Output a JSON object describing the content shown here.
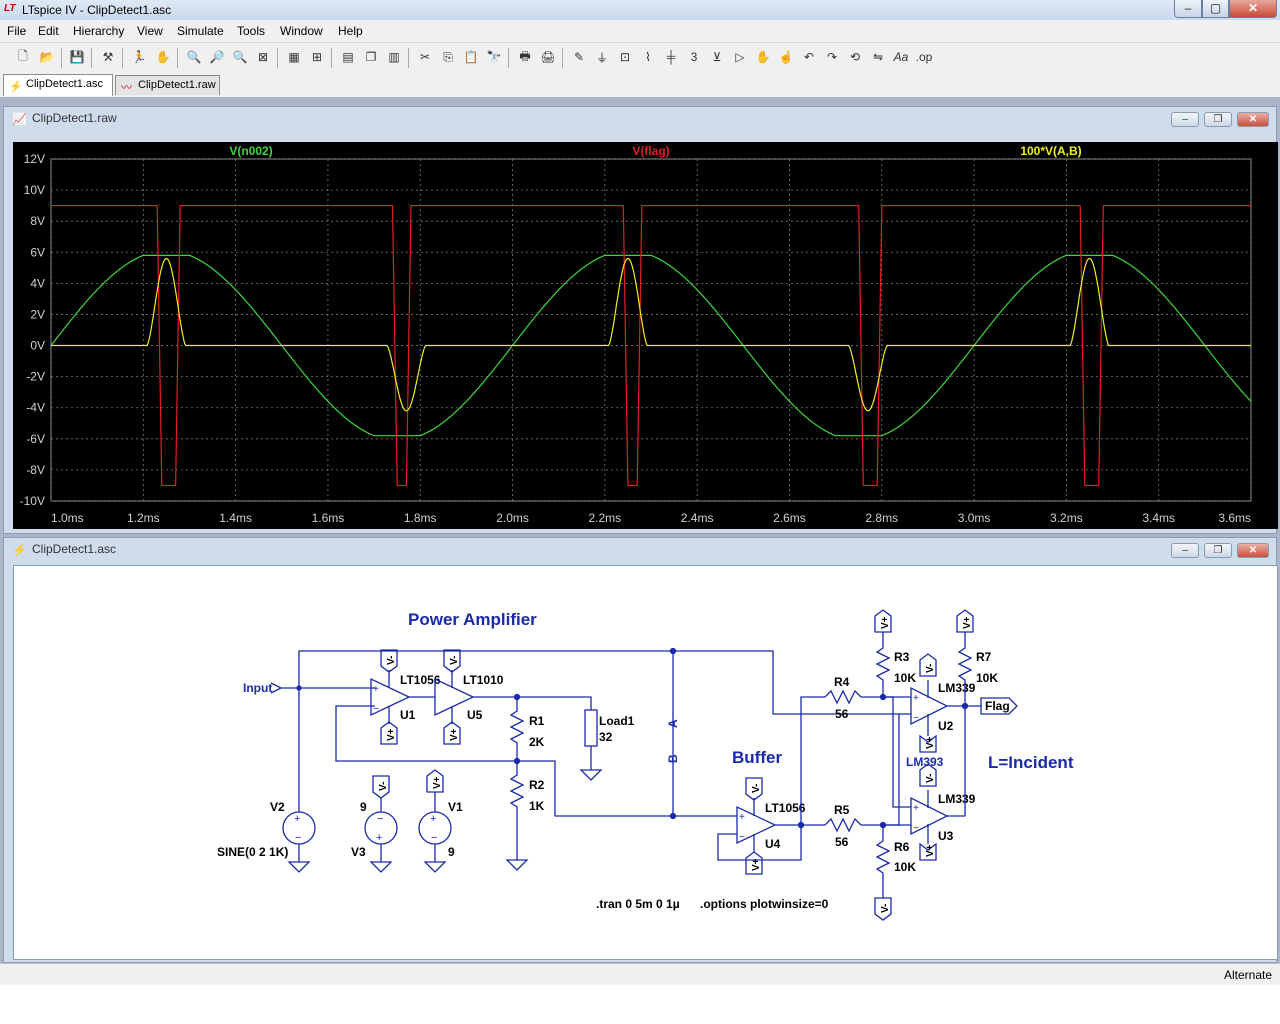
{
  "window": {
    "title": "LTspice IV - ClipDetect1.asc",
    "app_icon": "ltspice-logo-icon",
    "controls": {
      "minimize": "–",
      "maximize": "▢",
      "close": "✕"
    }
  },
  "menu": [
    "File",
    "Edit",
    "Hierarchy",
    "View",
    "Simulate",
    "Tools",
    "Window",
    "Help"
  ],
  "toolbar": {
    "icons": [
      "new-schematic-icon",
      "open-icon",
      "save-icon",
      "control-panel-icon",
      "run-icon",
      "halt-icon",
      "zoom-in-icon",
      "zoom-pan-icon",
      "zoom-out-icon",
      "zoom-fit-icon",
      "autorange-icon",
      "grid-icon",
      "tile-horizontal-icon",
      "cascade-icon",
      "tile-vertical-icon",
      "cut-icon",
      "copy-icon",
      "paste-icon",
      "find-icon",
      "print-setup-icon",
      "print-icon",
      "wire-icon",
      "ground-icon",
      "label-icon",
      "resistor-icon",
      "capacitor-icon",
      "inductor-icon",
      "diode-icon",
      "component-icon",
      "move-icon",
      "drag-icon",
      "undo-icon",
      "redo-icon",
      "rotate-icon",
      "mirror-icon",
      "text-icon",
      "spice-directive-icon"
    ]
  },
  "tabs": [
    {
      "label": "ClipDetect1.asc",
      "icon": "schematic-icon",
      "active": true
    },
    {
      "label": "ClipDetect1.raw",
      "icon": "waveform-icon",
      "active": false
    }
  ],
  "plot_window": {
    "title": "ClipDetect1.raw",
    "traces": [
      {
        "label": "V(n002)",
        "color": "#3cd63c"
      },
      {
        "label": "V(flag)",
        "color": "#e02020"
      },
      {
        "label": "100*V(A,B)",
        "color": "#f0f020"
      }
    ],
    "y_ticks": [
      "12V",
      "10V",
      "8V",
      "6V",
      "4V",
      "2V",
      "0V",
      "-2V",
      "-4V",
      "-6V",
      "-8V",
      "-10V"
    ],
    "x_ticks": [
      "1.0ms",
      "1.2ms",
      "1.4ms",
      "1.6ms",
      "1.8ms",
      "2.0ms",
      "2.2ms",
      "2.4ms",
      "2.6ms",
      "2.8ms",
      "3.0ms",
      "3.2ms",
      "3.4ms",
      "3.6ms"
    ]
  },
  "chart_data": {
    "type": "line",
    "xlim": [
      1.0,
      3.6
    ],
    "ylim": [
      -10,
      12
    ],
    "x_unit": "ms",
    "y_unit": "V",
    "grid": true,
    "legend": "top",
    "series": [
      {
        "name": "V(n002)",
        "description_values": {
          "frequency_kHz": 1,
          "amplitude_V": 6,
          "clip_V": 5.8,
          "x": [
            1.0,
            1.25,
            1.5,
            1.75,
            2.0,
            2.25,
            2.5,
            2.75,
            3.0,
            3.25,
            3.5,
            3.6
          ],
          "y": [
            0,
            5.8,
            0,
            -5.8,
            0,
            5.8,
            0,
            -5.8,
            0,
            5.8,
            0,
            -3.5
          ]
        }
      },
      {
        "name": "V(flag)",
        "x": [
          1.0,
          1.23,
          1.24,
          1.27,
          1.28,
          1.74,
          1.75,
          1.77,
          1.78,
          2.24,
          2.25,
          2.27,
          2.28,
          2.75,
          2.76,
          2.79,
          2.8,
          3.23,
          3.24,
          3.27,
          3.28,
          3.6
        ],
        "y": [
          9,
          9,
          -9,
          -9,
          9,
          9,
          -9,
          -9,
          9,
          9,
          -9,
          -9,
          9,
          9,
          -9,
          -9,
          9,
          9,
          -9,
          -9,
          9,
          9
        ]
      },
      {
        "name": "100*V(A,B)",
        "x": [
          1.0,
          1.21,
          1.25,
          1.29,
          1.73,
          1.77,
          1.81,
          2.21,
          2.25,
          2.29,
          2.73,
          2.77,
          2.81,
          3.21,
          3.25,
          3.29,
          3.6
        ],
        "y": [
          0,
          0,
          5.6,
          0,
          0,
          -4.2,
          0,
          0,
          5.6,
          0,
          0,
          -4.2,
          0,
          0,
          5.6,
          0,
          0
        ]
      }
    ]
  },
  "schematic_window": {
    "title": "ClipDetect1.asc",
    "labels": {
      "power_amp": "Power Amplifier",
      "buffer": "Buffer",
      "incident": "L=Incident",
      "input": "Input",
      "flag": "Flag",
      "tran": ".tran 0 5m 0 1µ",
      "options": ".options plotwinsize=0",
      "lt1056_a": "LT1056",
      "lt1010": "LT1010",
      "u1": "U1",
      "u5": "U5",
      "r1": "R1",
      "r1v": "2K",
      "r2": "R2",
      "r2v": "1K",
      "load1": "Load1",
      "load1v": "32",
      "a_label": "A",
      "b_label": "B",
      "v2": "V2",
      "sine": "SINE(0 2 1K)",
      "v3": "V3",
      "v1": "V1",
      "nine_a": "9",
      "nine_b": "9",
      "lt1056_b": "LT1056",
      "u4": "U4",
      "r4": "R4",
      "r4v": "56",
      "r5": "R5",
      "r5v": "56",
      "r3": "R3",
      "r3v": "10K",
      "r6": "R6",
      "r6v": "10K",
      "r7": "R7",
      "r7v": "10K",
      "lm339_a": "LM339",
      "lm339_b": "LM339",
      "u2": "U2",
      "u3": "U3",
      "lm393": "LM393",
      "vplus": "V+",
      "vminus": "V-"
    }
  },
  "status": {
    "text": "Alternate"
  }
}
